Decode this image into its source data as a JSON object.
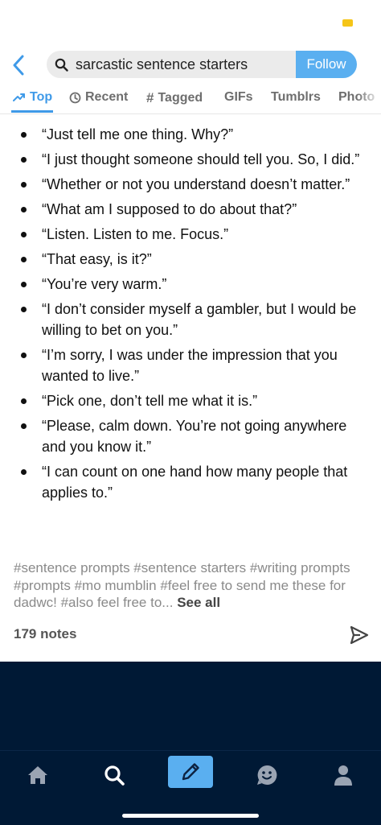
{
  "search": {
    "query": "sarcastic sentence starters",
    "follow_label": "Follow"
  },
  "tabs": [
    {
      "label": "Top"
    },
    {
      "label": "Recent"
    },
    {
      "label": "Tagged"
    },
    {
      "label": "GIFs"
    },
    {
      "label": "Tumblrs"
    },
    {
      "label": "Photo"
    }
  ],
  "post": {
    "quotes": [
      "“Just tell me one thing. Why?”",
      "“I just thought someone should tell you. So, I did.”",
      "“Whether or not you understand doesn’t matter.”",
      "“What am I supposed to do about that?”",
      "“Listen. Listen to me. Focus.”",
      "“That easy, is it?”",
      "“You’re very warm.”",
      "“I don’t consider myself a gambler, but I would be willing to bet on you.”",
      "“I’m sorry, I was under the impression that you wanted to live.”",
      "“Pick one, don’t tell me what it is.”",
      "“Please, calm down. You’re not going anywhere and you know it.”",
      "“I can count on one hand how many people that applies to.”"
    ],
    "tags_text": "#sentence prompts #sentence starters #writing prompts #prompts #mo mumblin #feel free to send me these for dadwc! #also feel free to...",
    "see_all_label": "See all",
    "notes_label": "179 notes"
  },
  "colors": {
    "accent": "#5aaff0",
    "tab_active": "#3f9ae8",
    "nav_bg": "#001935",
    "battery": "#f5c518"
  },
  "icons": {
    "back": "back-chevron-icon",
    "search": "search-icon",
    "share": "send-icon",
    "nav": [
      "home-icon",
      "search-icon",
      "pencil-icon",
      "smiley-icon",
      "person-icon"
    ]
  }
}
